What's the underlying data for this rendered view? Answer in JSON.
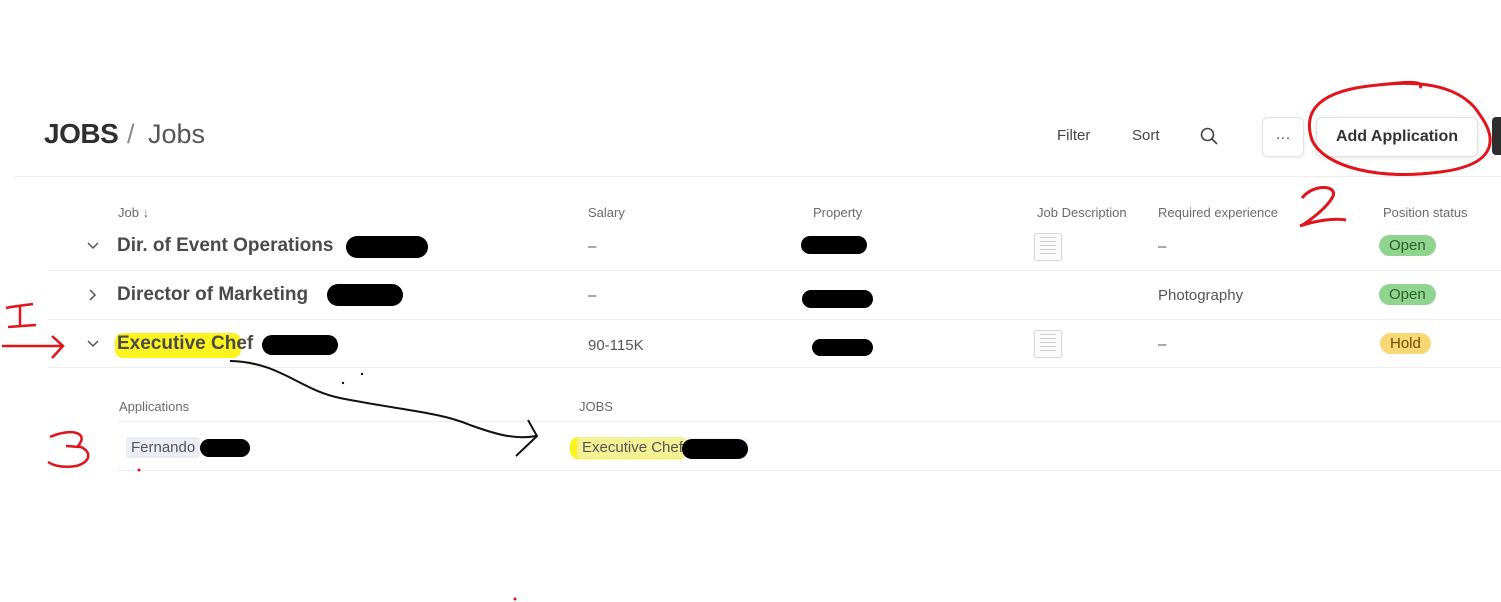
{
  "header": {
    "breadcrumb_root": "JOBS",
    "breadcrumb_sep": "/",
    "breadcrumb_page": "Jobs",
    "filter_label": "Filter",
    "sort_label": "Sort",
    "more_label": "···",
    "add_label": "Add Application"
  },
  "table": {
    "columns": [
      "Job",
      "Salary",
      "Property",
      "Job Description",
      "Required experience",
      "Position status"
    ],
    "job_sort_arrow": "↓",
    "rows": [
      {
        "title": "Dir. of Event Operations",
        "salary": "–",
        "experience": "–",
        "status": "Open",
        "expanded": true
      },
      {
        "title": "Director of Marketing",
        "salary": "–",
        "experience": "Photography",
        "status": "Open",
        "expanded": false
      },
      {
        "title": "Executive Chef",
        "salary": "90-115K",
        "experience": "–",
        "status": "Hold",
        "expanded": true
      }
    ]
  },
  "subtable": {
    "col_applications": "Applications",
    "col_jobs": "JOBS",
    "application": "Fernando",
    "job": "Executive Chef"
  },
  "annotations": [
    "1",
    "2",
    "3"
  ],
  "colors": {
    "open": "#8fd48f",
    "hold": "#f8d774",
    "highlight": "#fdf31e",
    "red_ink": "#e0141b"
  }
}
